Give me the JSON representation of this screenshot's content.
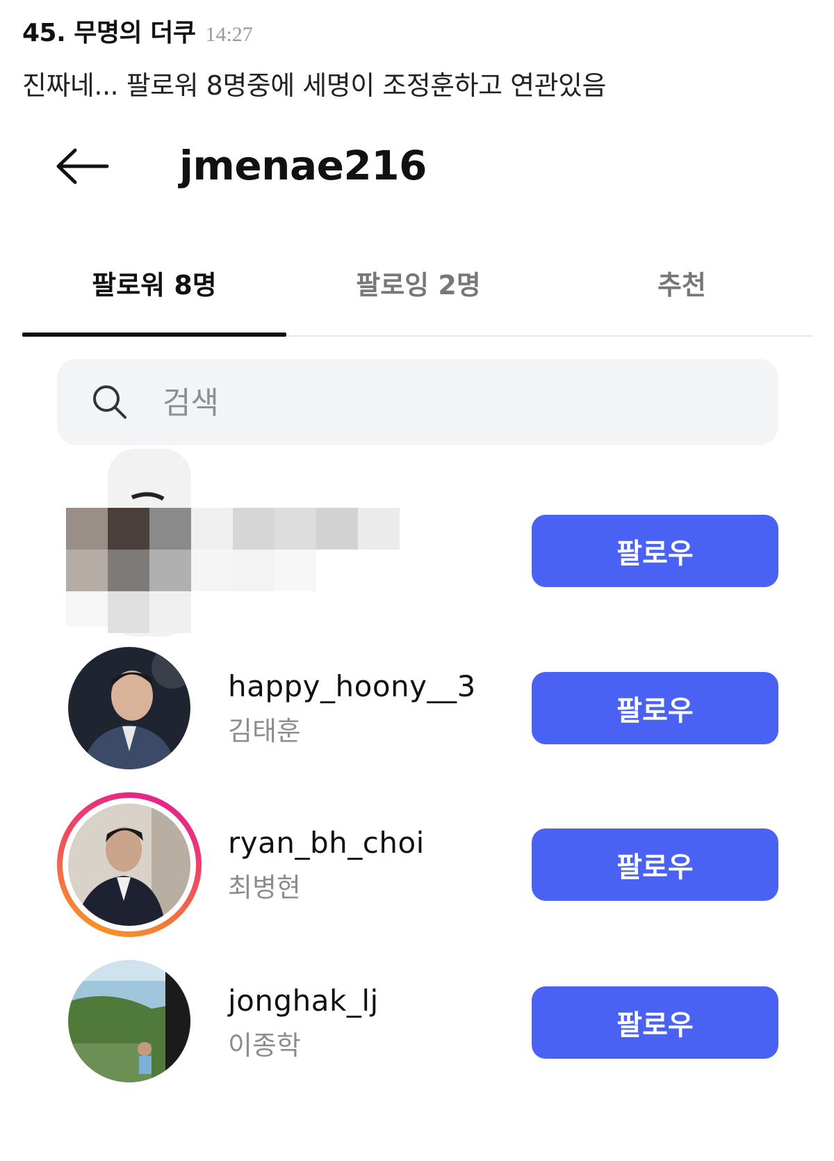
{
  "comment": {
    "number_and_author": "45. 무명의 더쿠",
    "time": "14:27",
    "text": "진짜네... 팔로워 8명중에 세명이 조정훈하고 연관있음"
  },
  "header": {
    "username": "jmenae216",
    "back_icon": "arrow-left-icon"
  },
  "tabs": [
    {
      "label": "팔로워 8명",
      "active": true
    },
    {
      "label": "팔로잉 2명",
      "active": false
    },
    {
      "label": "추천",
      "active": false
    }
  ],
  "search": {
    "placeholder": "검색",
    "icon": "search-icon"
  },
  "followers": [
    {
      "username": "",
      "full_name": "",
      "button": "팔로우",
      "redacted": true
    },
    {
      "username": "happy_hoony__3",
      "full_name": "김태훈",
      "button": "팔로우",
      "story_ring": false
    },
    {
      "username": "ryan_bh_choi",
      "full_name": "최병현",
      "button": "팔로우",
      "story_ring": true
    },
    {
      "username": "jonghak_lj",
      "full_name": "이종학",
      "button": "팔로우",
      "story_ring": false
    }
  ],
  "colors": {
    "follow_button": "#4a62f3",
    "story_ring_start": "#f9a21b",
    "story_ring_end": "#e1179b"
  }
}
